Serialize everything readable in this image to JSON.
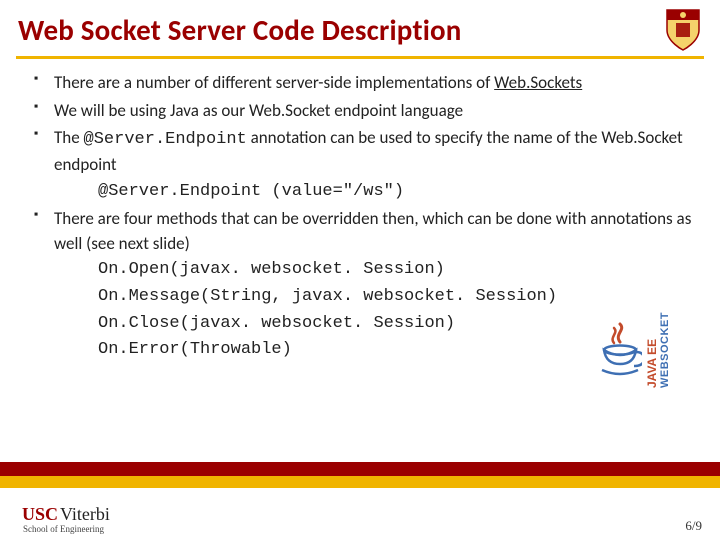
{
  "slide": {
    "title": "Web Socket Server Code Description",
    "bullets": [
      {
        "parts": [
          {
            "t": "There are a number of different server-side implementations of "
          },
          {
            "t": "Web.Sockets",
            "link": true
          }
        ]
      },
      {
        "parts": [
          {
            "t": "We will be using Java as our Web.Socket endpoint language"
          }
        ]
      },
      {
        "parts": [
          {
            "t": "The "
          },
          {
            "t": "@Server.Endpoint",
            "mono": true
          },
          {
            "t": " annotation can be used to specify the name of the Web.Socket endpoint"
          }
        ],
        "sub": [
          {
            "t": "@Server.Endpoint (value=\"/ws\")",
            "mono": true
          }
        ]
      },
      {
        "parts": [
          {
            "t": "There are four methods that can be overridden then, which can be done with annotations as well (see next slide)"
          }
        ],
        "sub": [
          {
            "t": "On.Open(javax. websocket. Session)",
            "mono": true
          },
          {
            "t": "On.Message(String, javax. websocket. Session)",
            "mono": true
          },
          {
            "t": "On.Close(javax. websocket. Session)",
            "mono": true
          },
          {
            "t": "On.Error(Throwable)",
            "mono": true
          }
        ]
      }
    ]
  },
  "badge": {
    "line1": "JAVA EE",
    "line2": "WEBSOCKET"
  },
  "footer": {
    "logo_usc": "USC",
    "logo_viterbi": "Viterbi",
    "logo_school": "School of Engineering",
    "page": "6/9"
  },
  "colors": {
    "cardinal": "#9a0000",
    "gold": "#f0b400"
  }
}
